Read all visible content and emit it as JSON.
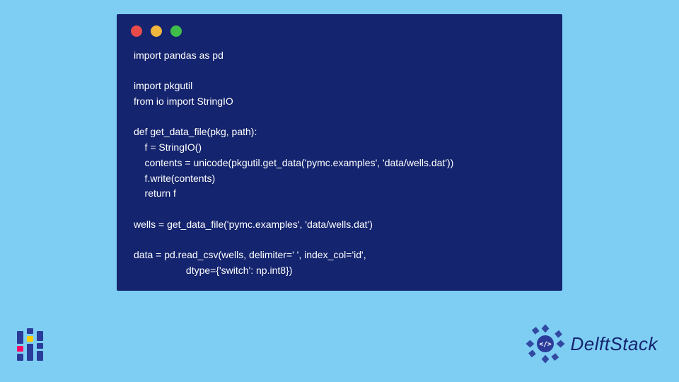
{
  "window": {
    "dots": [
      "red",
      "yellow",
      "green"
    ]
  },
  "code": {
    "lines": [
      "import pandas as pd",
      "",
      "import pkgutil",
      "from io import StringIO",
      "",
      "def get_data_file(pkg, path):",
      "    f = StringIO()",
      "    contents = unicode(pkgutil.get_data('pymc.examples', 'data/wells.dat'))",
      "    f.write(contents)",
      "    return f",
      "",
      "wells = get_data_file('pymc.examples', 'data/wells.dat')",
      "",
      "data = pd.read_csv(wells, delimiter=' ', index_col='id',",
      "                   dtype={'switch': np.int8})"
    ]
  },
  "branding": {
    "name": "DelftStack",
    "badge_text": "</>"
  }
}
